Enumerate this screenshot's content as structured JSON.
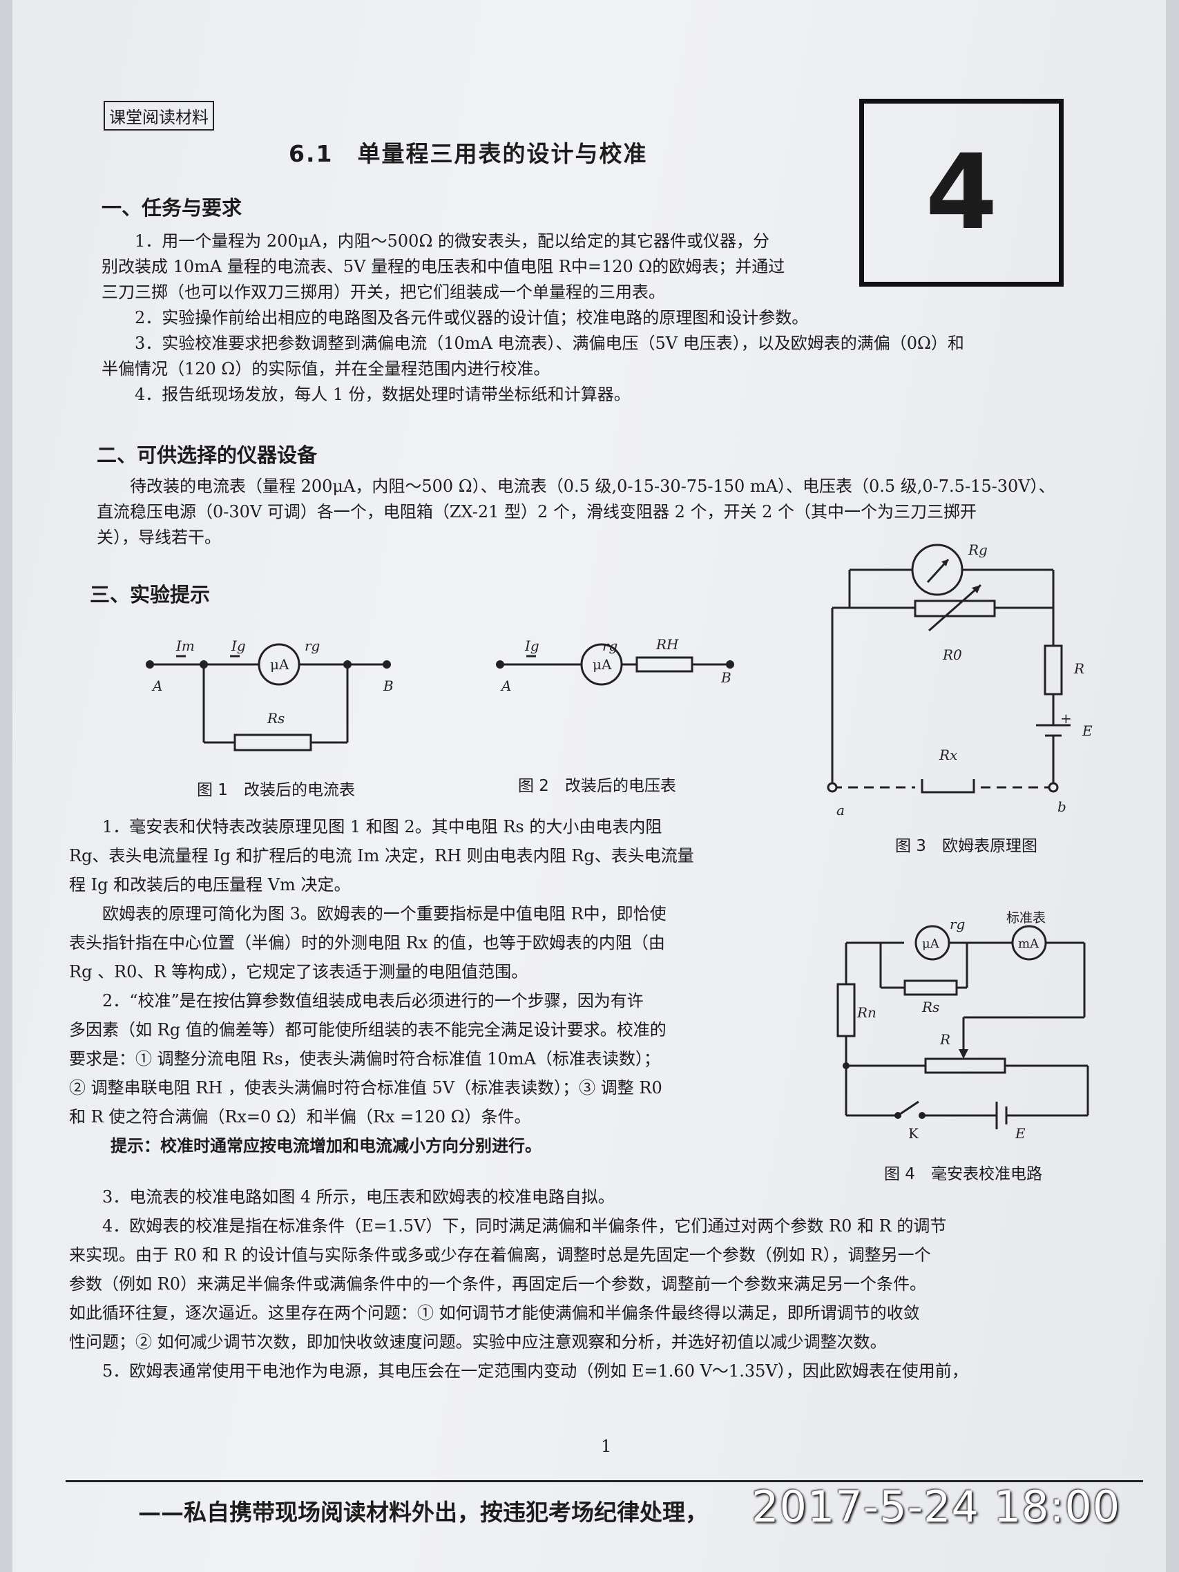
{
  "tag": "课堂阅读材料",
  "chapter_number": "4",
  "title": "6.1　单量程三用表的设计与校准",
  "sections": {
    "s1": "一、任务与要求",
    "s2": "二、可供选择的仪器设备",
    "s3": "三、实验提示"
  },
  "task_lines": [
    "　　1．用一个量程为 200μA，内阻～500Ω 的微安表头，配以给定的其它器件或仪器，分",
    "别改装成 10mA 量程的电流表、5V 量程的电压表和中值电阻 R中=120 Ω的欧姆表；并通过",
    "三刀三掷（也可以作双刀三掷用）开关，把它们组装成一个单量程的三用表。",
    "　　2．实验操作前给出相应的电路图及各元件或仪器的设计值；校准电路的原理图和设计参数。",
    "　　3．实验校准要求把参数调整到满偏电流（10mA 电流表）、满偏电压（5V 电压表），以及欧姆表的满偏（0Ω）和",
    "半偏情况（120 Ω）的实际值，并在全量程范围内进行校准。",
    "　　4．报告纸现场发放，每人 1 份，数据处理时请带坐标纸和计算器。"
  ],
  "equipment_lines": [
    "　　待改装的电流表（量程 200μA，内阻～500 Ω）、电流表（0.5 级,0-15-30-75-150 mA）、电压表（0.5 级,0-7.5-15-30V）、",
    "直流稳压电源（0-30V 可调）各一个，电阻箱（ZX-21 型）2 个，滑线变阻器 2 个，开关 2 个（其中一个为三刀三掷开",
    "关），导线若干。"
  ],
  "hint_lines_left": [
    "　　1．毫安表和伏特表改装原理见图 1 和图 2。其中电阻 Rs 的大小由电表内阻",
    "Rg、表头电流量程 Ig 和扩程后的电流 Im 决定，RH 则由电表内阻 Rg、表头电流量",
    "程 Ig 和改装后的电压量程 Vm 决定。",
    "　　欧姆表的原理可简化为图 3。欧姆表的一个重要指标是中值电阻 R中，即恰使",
    "表头指针指在中心位置（半偏）时的外测电阻 Rx 的值，也等于欧姆表的内阻（由",
    "Rg 、R0、R 等构成），它规定了该表适于测量的电阻值范围。",
    "　　2．“校准”是在按估算参数值组装成电表后必须进行的一个步骤，因为有许",
    "多因素（如 Rg 值的偏差等）都可能使所组装的表不能完全满足设计要求。校准的",
    "要求是：① 调整分流电阻 Rs，使表头满偏时符合标准值 10mA（标准表读数）；",
    "② 调整串联电阻 RH ，使表头满偏时符合标准值 5V（标准表读数）；③ 调整 R0",
    "和 R 使之符合满偏（Rx=0 Ω）和半偏（Rx =120 Ω）条件。"
  ],
  "tip": "提示：校准时通常应按电流增加和电流减小方向分别进行。",
  "hint_lines_full": [
    "　　3．电流表的校准电路如图 4 所示，电压表和欧姆表的校准电路自拟。",
    "　　4．欧姆表的校准是指在标准条件（E=1.5V）下，同时满足满偏和半偏条件，它们通过对两个参数 R0 和 R 的调节",
    "来实现。由于 R0 和 R 的设计值与实际条件或多或少存在着偏离，调整时总是先固定一个参数（例如 R），调整另一个",
    "参数（例如 R0）来满足半偏条件或满偏条件中的一个条件，再固定后一个参数，调整前一个参数来满足另一个条件。",
    "如此循环往复，逐次逼近。这里存在两个问题：① 如何调节才能使满偏和半偏条件最终得以满足，即所谓调节的收敛",
    "性问题；② 如何减少调节次数，即加快收敛速度问题。实验中应注意观察和分析，并选好初值以减少调整次数。",
    "　　5．欧姆表通常使用干电池作为电源，其电压会在一定范围内变动（例如 E=1.60 V～1.35V），因此欧姆表在使用前，"
  ],
  "captions": {
    "fig1": "图 1　改装后的电流表",
    "fig2": "图 2　改装后的电压表",
    "fig3": "图 3　欧姆表原理图",
    "fig4": "图 4　毫安表校准电路"
  },
  "fig_labels": {
    "Im": "Im",
    "Ig": "Ig",
    "rg": "rg",
    "uA": "μA",
    "mA": "mA",
    "A": "A",
    "B": "B",
    "Rs": "Rs",
    "RH": "RH",
    "Rg": "Rg",
    "R0": "R0",
    "R": "R",
    "E": "E",
    "Rx": "Rx",
    "a": "a",
    "b": "b",
    "Rn": "Rn",
    "K": "K",
    "std": "标准表",
    "plus": "+"
  },
  "page_number": "1",
  "footer": "——私自携带现场阅读材料外出，按违犯考场纪律处理，",
  "timestamp": "2017-5-24 18:00"
}
